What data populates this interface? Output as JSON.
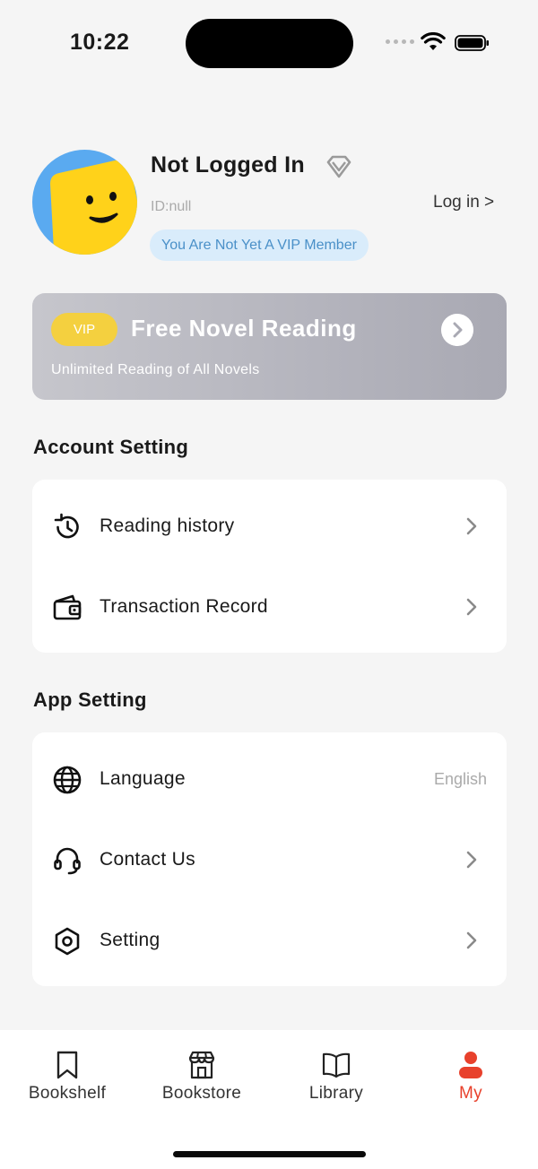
{
  "status_bar": {
    "time": "10:22"
  },
  "profile": {
    "username": "Not Logged In",
    "user_id": "ID:null",
    "login_link": "Log in >",
    "vip_status": "You Are Not Yet A VIP Member"
  },
  "vip_banner": {
    "tag": "VIP",
    "title": "Free Novel Reading",
    "subtitle": "Unlimited Reading of All Novels"
  },
  "account_setting": {
    "title": "Account Setting",
    "items": [
      {
        "label": "Reading history",
        "icon": "history-icon"
      },
      {
        "label": "Transaction Record",
        "icon": "wallet-icon"
      }
    ]
  },
  "app_setting": {
    "title": "App Setting",
    "items": [
      {
        "label": "Language",
        "icon": "globe-icon",
        "value": "English"
      },
      {
        "label": "Contact Us",
        "icon": "headset-icon"
      },
      {
        "label": "Setting",
        "icon": "settings-hexagon-icon"
      }
    ]
  },
  "tab_bar": {
    "tabs": [
      {
        "label": "Bookshelf",
        "icon": "bookmark-icon",
        "active": false
      },
      {
        "label": "Bookstore",
        "icon": "store-icon",
        "active": false
      },
      {
        "label": "Library",
        "icon": "book-icon",
        "active": false
      },
      {
        "label": "My",
        "icon": "user-icon",
        "active": true
      }
    ]
  },
  "colors": {
    "accent_active": "#e8412c",
    "vip_yellow": "#f4d03f",
    "vip_pill_bg": "#d9ecfb",
    "vip_pill_text": "#4a90c8",
    "avatar_blue": "#5aaaf0",
    "avatar_yellow": "#ffd21a"
  }
}
